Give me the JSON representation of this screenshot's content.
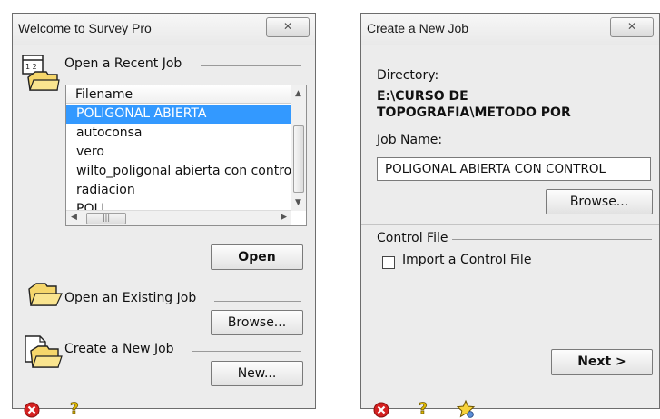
{
  "welcome": {
    "title": "Welcome to Survey Pro",
    "close_glyph": "✕",
    "recent_heading": "Open a Recent Job",
    "list_header": "Filename",
    "recent_files": [
      "POLIGONAL ABIERTA",
      "autoconsa",
      "vero",
      "wilto_poligonal abierta con control",
      "radiacion",
      "POLI"
    ],
    "selected_index": 0,
    "open_label": "Open",
    "existing_heading": "Open an Existing Job",
    "browse_label": "Browse...",
    "new_heading": "Create a New Job",
    "new_label": "New...",
    "icons": [
      "calendar-folder-icon",
      "folder-icon",
      "new-job-folder-icon",
      "error-icon",
      "help-icon"
    ]
  },
  "create": {
    "title": "Create a New Job",
    "close_glyph": "✕",
    "directory_label": "Directory:",
    "directory_value_line1": "E:\\CURSO DE",
    "directory_value_line2": "TOPOGRAFIA\\METODO POR",
    "job_name_label": "Job Name:",
    "job_name_value": "POLIGONAL ABIERTA CON CONTROL",
    "browse_label": "Browse...",
    "control_file_heading": "Control File",
    "import_label": "Import a Control File",
    "import_checked": false,
    "next_label": "Next >",
    "icons": [
      "error-icon",
      "help-icon",
      "favorite-star-icon"
    ]
  },
  "colors": {
    "selection": "#3399ff",
    "window_bg": "#ececec",
    "error_red": "#d42020"
  }
}
